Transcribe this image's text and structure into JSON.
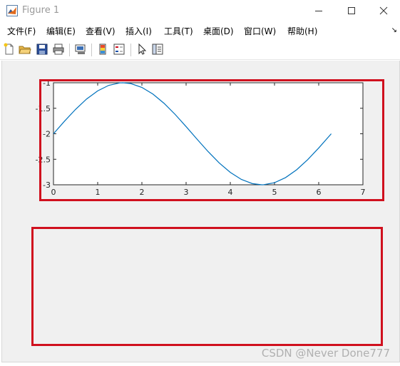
{
  "window": {
    "title": "Figure 1",
    "controls": [
      "minimize",
      "maximize",
      "close"
    ]
  },
  "menu": {
    "items": [
      "文件(F)",
      "编辑(E)",
      "查看(V)",
      "插入(I)",
      "工具(T)",
      "桌面(D)",
      "窗口(W)",
      "帮助(H)"
    ],
    "overflow": "↘"
  },
  "toolbar": {
    "icons": [
      "new-figure-icon",
      "open-file-icon",
      "save-icon",
      "print-icon",
      "link-plot-icon",
      "insert-colorbar-icon",
      "insert-legend-icon",
      "pointer-icon",
      "property-editor-icon"
    ]
  },
  "colors": {
    "highlight_box": "#d0101e",
    "plot_line": "#0072bd",
    "figure_background": "#f0f0f0"
  },
  "chart_data": {
    "type": "line",
    "title": "",
    "xlabel": "",
    "ylabel": "",
    "xlim": [
      0,
      7
    ],
    "ylim": [
      -3,
      -1
    ],
    "xticks": [
      "0",
      "1",
      "2",
      "3",
      "4",
      "5",
      "6",
      "7"
    ],
    "yticks": [
      "-1",
      "-1.5",
      "-2",
      "-2.5",
      "-3"
    ],
    "x": [
      0,
      0.25,
      0.5,
      0.75,
      1,
      1.25,
      1.5,
      1.5708,
      1.75,
      2,
      2.25,
      2.5,
      2.75,
      3,
      3.25,
      3.5,
      3.75,
      4,
      4.25,
      4.5,
      4.7124,
      4.75,
      5,
      5.25,
      5.5,
      5.75,
      6,
      6.2832
    ],
    "y": [
      -2,
      -1.753,
      -1.521,
      -1.318,
      -1.159,
      -1.051,
      -1.003,
      -1,
      -1.016,
      -1.091,
      -1.222,
      -1.402,
      -1.619,
      -1.859,
      -2.108,
      -2.351,
      -2.572,
      -2.757,
      -2.895,
      -2.977,
      -3,
      -2.999,
      -2.959,
      -2.859,
      -2.706,
      -2.508,
      -2.279,
      -2
    ],
    "grid": false
  },
  "watermark": "CSDN @Never Done777"
}
